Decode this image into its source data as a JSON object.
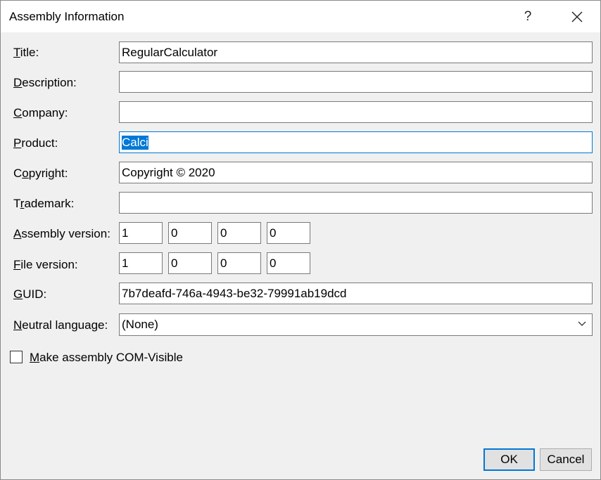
{
  "window": {
    "title": "Assembly Information",
    "help_label": "?"
  },
  "fields": {
    "title": {
      "label_acc": "T",
      "label_rest": "itle:",
      "value": "RegularCalculator"
    },
    "description": {
      "label_acc": "D",
      "label_rest": "escription:",
      "value": ""
    },
    "company": {
      "label_acc": "C",
      "label_rest": "ompany:",
      "value": ""
    },
    "product": {
      "label_acc": "P",
      "label_rest": "roduct:",
      "value_selected": "Calci"
    },
    "copyright": {
      "label_pre": "C",
      "label_acc": "o",
      "label_rest": "pyright:",
      "value": "Copyright ©  2020"
    },
    "trademark": {
      "label_pre": "T",
      "label_acc": "r",
      "label_rest": "ademark:",
      "value": ""
    },
    "assembly_version": {
      "label_acc": "A",
      "label_rest": "ssembly version:",
      "parts": [
        "1",
        "0",
        "0",
        "0"
      ]
    },
    "file_version": {
      "label_acc": "F",
      "label_rest": "ile version:",
      "parts": [
        "1",
        "0",
        "0",
        "0"
      ]
    },
    "guid": {
      "label_acc": "G",
      "label_rest": "UID:",
      "value": "7b7deafd-746a-4943-be32-79991ab19dcd"
    },
    "neutral_language": {
      "label_acc": "N",
      "label_rest": "eutral language:",
      "value": "(None)"
    }
  },
  "com_visible": {
    "label_acc": "M",
    "label_rest": "ake assembly COM-Visible",
    "checked": false
  },
  "buttons": {
    "ok": "OK",
    "cancel": "Cancel"
  },
  "icons": {
    "close": "close-icon",
    "dropdown": "chevron-down-icon"
  },
  "colors": {
    "accent": "#0078d7",
    "background": "#f0f0f0"
  }
}
